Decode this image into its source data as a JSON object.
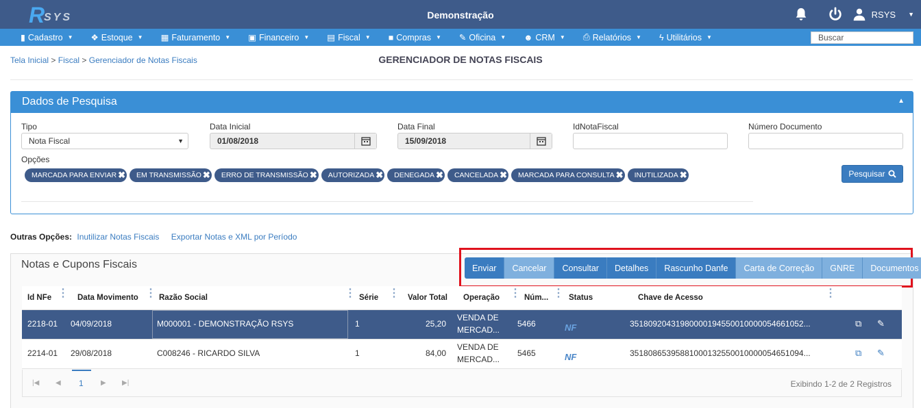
{
  "topbar": {
    "logo_text": "RSYS",
    "app_title": "Demonstração",
    "user_name": "RSYS",
    "icons": [
      "bell-icon",
      "power-icon",
      "user-icon",
      "caret-down-icon"
    ]
  },
  "navbar": {
    "items": [
      {
        "label": "Cadastro",
        "icon": "book-icon"
      },
      {
        "label": "Estoque",
        "icon": "cubes-icon"
      },
      {
        "label": "Faturamento",
        "icon": "calculator-icon"
      },
      {
        "label": "Financeiro",
        "icon": "money-icon"
      },
      {
        "label": "Fiscal",
        "icon": "file-icon"
      },
      {
        "label": "Compras",
        "icon": "truck-icon"
      },
      {
        "label": "Oficina",
        "icon": "wrench-icon"
      },
      {
        "label": "CRM",
        "icon": "users-icon"
      },
      {
        "label": "Relatórios",
        "icon": "print-icon"
      },
      {
        "label": "Utilitários",
        "icon": "bolt-icon"
      }
    ],
    "search_placeholder": "Buscar"
  },
  "breadcrumb": {
    "items": [
      "Tela Inicial",
      "Fiscal",
      "Gerenciador de Notas Fiscais"
    ],
    "separator": ">"
  },
  "page_title": "GERENCIADOR DE NOTAS FISCAIS",
  "search_panel": {
    "title": "Dados de Pesquisa",
    "tipo_label": "Tipo",
    "tipo_value": "Nota Fiscal",
    "data_inicial_label": "Data Inicial",
    "data_inicial_value": "01/08/2018",
    "data_final_label": "Data Final",
    "data_final_value": "15/09/2018",
    "id_nota_label": "IdNotaFiscal",
    "id_nota_value": "",
    "numero_doc_label": "Número Documento",
    "numero_doc_value": "",
    "opcoes_label": "Opções",
    "tags": [
      "MARCADA PARA ENVIAR",
      "EM TRANSMISSÃO",
      "ERRO DE TRANSMISSÃO",
      "AUTORIZADA",
      "DENEGADA",
      "CANCELADA",
      "MARCADA PARA CONSULTA",
      "INUTILIZADA"
    ],
    "search_button": "Pesquisar"
  },
  "outras_opcoes": {
    "label": "Outras Opções:",
    "links": [
      "Inutilizar Notas Fiscais",
      "Exportar Notas e XML por Período"
    ]
  },
  "grid": {
    "title": "Notas e Cupons Fiscais",
    "actions": [
      {
        "label": "Enviar",
        "style": "dark"
      },
      {
        "label": "Cancelar",
        "style": "light"
      },
      {
        "label": "Consultar",
        "style": "dark"
      },
      {
        "label": "Detalhes",
        "style": "dark"
      },
      {
        "label": "Rascunho Danfe",
        "style": "dark"
      },
      {
        "label": "Carta de Correção",
        "style": "light"
      },
      {
        "label": "GNRE",
        "style": "light"
      },
      {
        "label": "Documentos",
        "style": "light"
      }
    ],
    "columns": [
      "Id NFe",
      "Data Movimento",
      "Razão Social",
      "Série",
      "Valor Total",
      "Operação",
      "Núm...",
      "Status",
      "Chave de Acesso"
    ],
    "rows": [
      {
        "id": "2218-01",
        "data": "04/09/2018",
        "razao": "M000001 - DEMONSTRAÇÃO RSYS",
        "serie": "1",
        "valor": "25,20",
        "operacao1": "VENDA DE",
        "operacao2": "MERCAD...",
        "numero": "5466",
        "status": "NF",
        "chave": "351809204319800001945500100000546610​52..."
      },
      {
        "id": "2214-01",
        "data": "29/08/2018",
        "razao": "C008246 - RICARDO SILVA",
        "serie": "1",
        "valor": "84,00",
        "operacao1": "VENDA DE",
        "operacao2": "MERCAD...",
        "numero": "5465",
        "status": "NF",
        "chave": "35180865395881000132550010000054651094..."
      }
    ],
    "pager": {
      "current_page": "1",
      "info": "Exibindo 1-2 de 2 Registros"
    }
  },
  "colors": {
    "topbar": "#3e5b8a",
    "navbar": "#3a8fd6",
    "accent": "#3a7cc0",
    "highlight_frame": "#e0121d"
  }
}
